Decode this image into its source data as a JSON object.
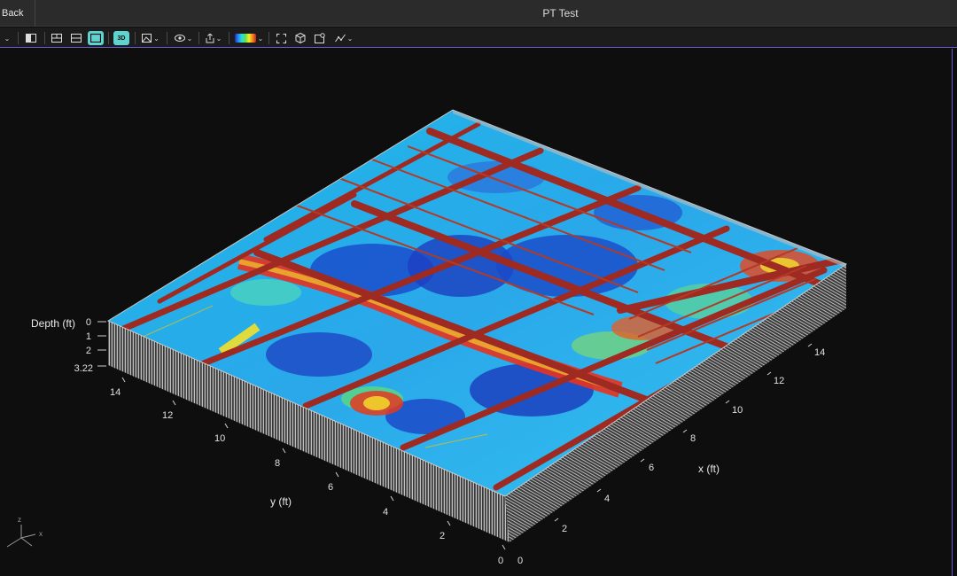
{
  "titlebar": {
    "back_label": "Back",
    "title": "PT Test"
  },
  "toolbar": {
    "icons": [
      "layout-icon",
      "split-horizontal-icon",
      "split-vertical-icon",
      "single-view-icon",
      "view-3d-icon",
      "image-adjust-icon",
      "visibility-icon",
      "export-icon",
      "colormap-icon",
      "fullscreen-icon",
      "cube-icon",
      "snapshot-icon",
      "chart-icon"
    ],
    "active": [
      "single-view-icon",
      "view-3d-icon"
    ],
    "view_3d_label": "3D"
  },
  "scene": {
    "depth_axis": {
      "title": "Depth (ft)",
      "ticks": [
        "0",
        "1",
        "2",
        "3.22"
      ]
    },
    "y_axis": {
      "title": "y (ft)",
      "ticks": [
        "0",
        "2",
        "4",
        "6",
        "8",
        "10",
        "12",
        "14"
      ]
    },
    "x_axis": {
      "title": "x (ft)",
      "ticks": [
        "0",
        "2",
        "4",
        "6",
        "8",
        "10",
        "12",
        "14"
      ]
    },
    "orientation": {
      "z": "z",
      "x": "x"
    }
  }
}
